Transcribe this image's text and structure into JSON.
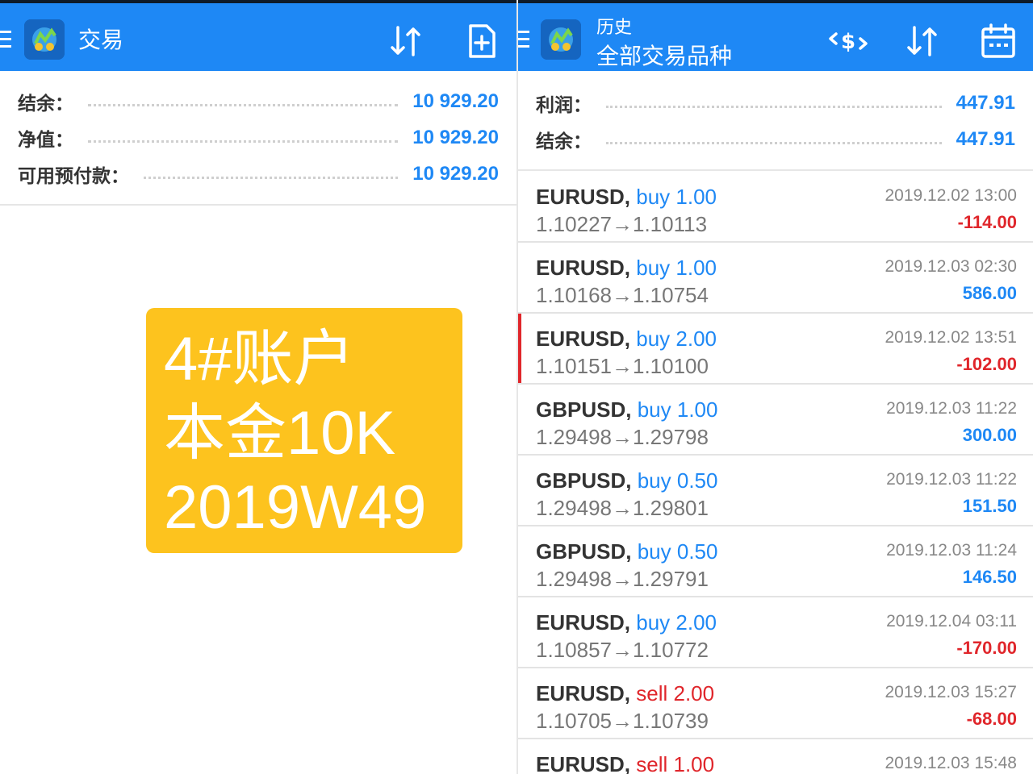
{
  "left": {
    "header": {
      "title": "交易"
    },
    "summary": [
      {
        "label": "结余：",
        "value": "10 929.20"
      },
      {
        "label": "净值：",
        "value": "10 929.20"
      },
      {
        "label": "可用预付款：",
        "value": "10 929.20"
      }
    ],
    "badge": {
      "line1": "4#账户",
      "line2": "本金10K",
      "line3": "2019W49"
    }
  },
  "right": {
    "header": {
      "title": "历史",
      "subtitle": "全部交易品种"
    },
    "summary": [
      {
        "label": "利润：",
        "value": "447.91"
      },
      {
        "label": "结余：",
        "value": "447.91"
      }
    ],
    "trades": [
      {
        "symbol": "EURUSD,",
        "side": "buy",
        "volume": "1.00",
        "open": "1.10227",
        "close": "1.10113",
        "date": "2019.12.02 13:00",
        "profit": "-114.00"
      },
      {
        "symbol": "EURUSD,",
        "side": "buy",
        "volume": "1.00",
        "open": "1.10168",
        "close": "1.10754",
        "date": "2019.12.03 02:30",
        "profit": "586.00"
      },
      {
        "symbol": "EURUSD,",
        "side": "buy",
        "volume": "2.00",
        "open": "1.10151",
        "close": "1.10100",
        "date": "2019.12.02 13:51",
        "profit": "-102.00"
      },
      {
        "symbol": "GBPUSD,",
        "side": "buy",
        "volume": "1.00",
        "open": "1.29498",
        "close": "1.29798",
        "date": "2019.12.03 11:22",
        "profit": "300.00"
      },
      {
        "symbol": "GBPUSD,",
        "side": "buy",
        "volume": "0.50",
        "open": "1.29498",
        "close": "1.29801",
        "date": "2019.12.03 11:22",
        "profit": "151.50"
      },
      {
        "symbol": "GBPUSD,",
        "side": "buy",
        "volume": "0.50",
        "open": "1.29498",
        "close": "1.29791",
        "date": "2019.12.03 11:24",
        "profit": "146.50"
      },
      {
        "symbol": "EURUSD,",
        "side": "buy",
        "volume": "2.00",
        "open": "1.10857",
        "close": "1.10772",
        "date": "2019.12.04 03:11",
        "profit": "-170.00"
      },
      {
        "symbol": "EURUSD,",
        "side": "sell",
        "volume": "2.00",
        "open": "1.10705",
        "close": "1.10739",
        "date": "2019.12.03 15:27",
        "profit": "-68.00"
      },
      {
        "symbol": "EURUSD,",
        "side": "sell",
        "volume": "1.00",
        "open": "",
        "close": "",
        "date": "2019.12.03 15:48",
        "profit": ""
      }
    ],
    "arrow_glyph": "→"
  },
  "colors": {
    "header_bg": "#1e88f5",
    "accent_blue": "#1e88f5",
    "loss_red": "#e0262b",
    "badge_bg": "#fdc31e"
  },
  "icons": {
    "left_header": [
      "menu-icon",
      "app-logo-icon",
      "sort-icon",
      "new-order-icon"
    ],
    "right_header": [
      "menu-icon",
      "app-logo-icon",
      "deposit-filter-icon",
      "sort-icon",
      "calendar-icon"
    ]
  }
}
